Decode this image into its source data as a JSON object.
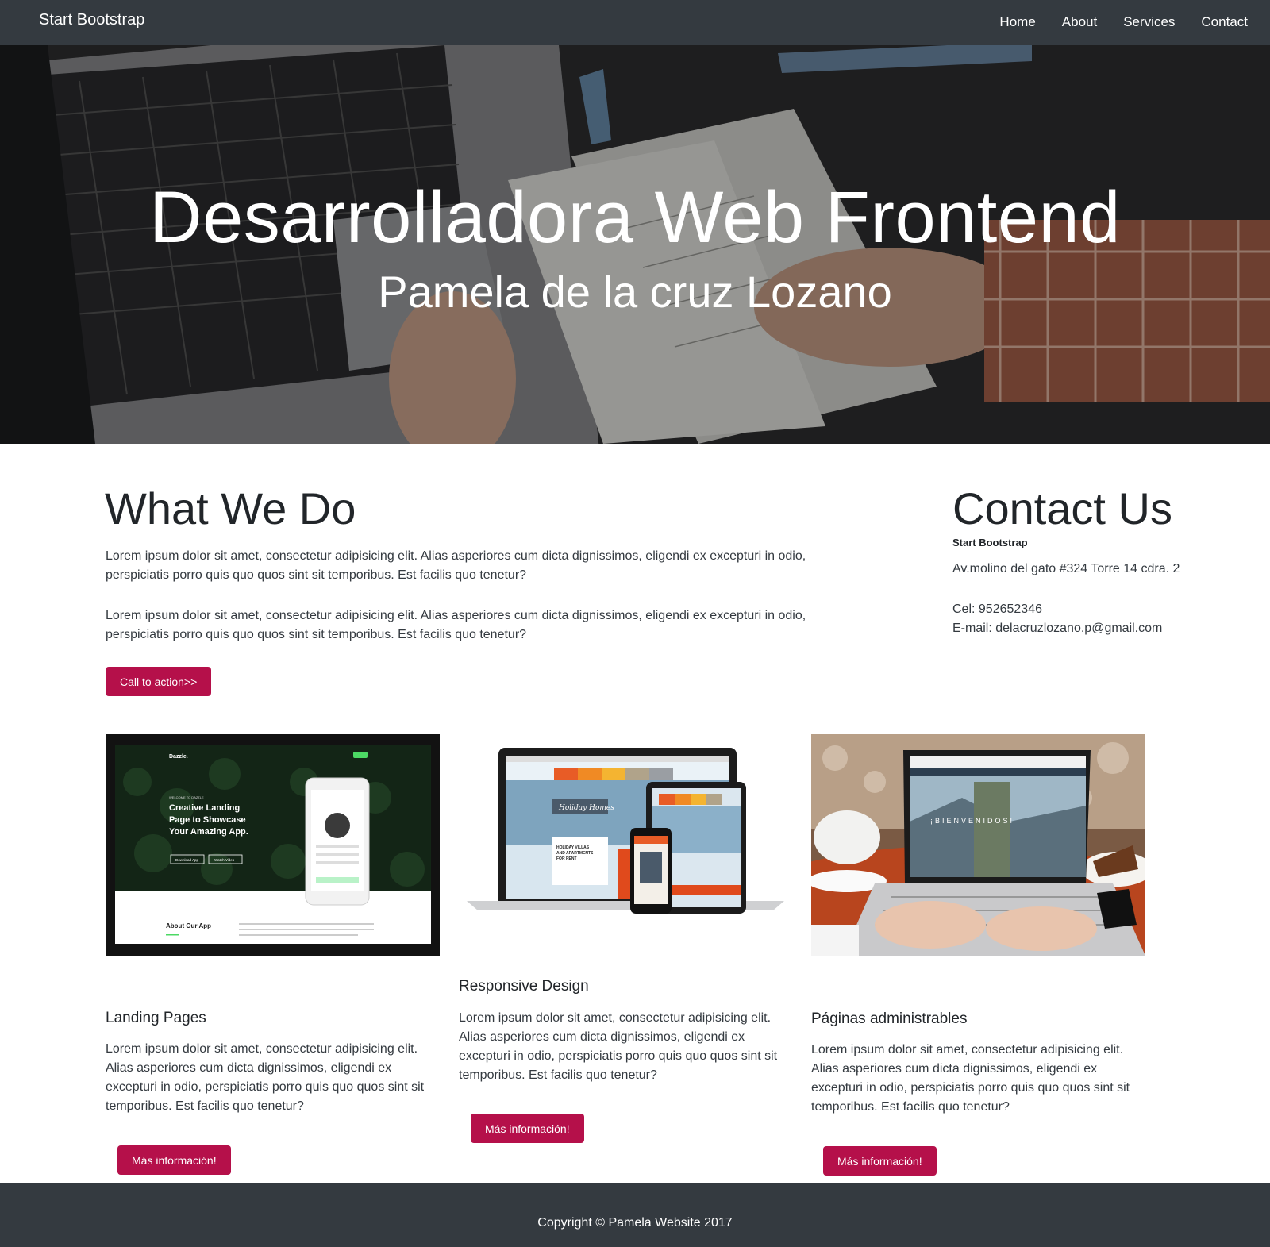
{
  "nav": {
    "brand": "Start Bootstrap",
    "links": [
      "Home",
      "About",
      "Services",
      "Contact"
    ]
  },
  "hero": {
    "title": "Desarrolladora Web Frontend",
    "subtitle": "Pamela de la cruz Lozano"
  },
  "what_we_do": {
    "heading": "What We Do",
    "paragraphs": [
      "Lorem ipsum dolor sit amet, consectetur adipisicing elit. Alias asperiores cum dicta dignissimos, eligendi ex excepturi in odio, perspiciatis porro quis quo quos sint sit temporibus. Est facilis quo tenetur?",
      "Lorem ipsum dolor sit amet, consectetur adipisicing elit. Alias asperiores cum dicta dignissimos, eligendi ex excepturi in odio, perspiciatis porro quis quo quos sint sit temporibus. Est facilis quo tenetur?"
    ],
    "cta": "Call to action>>"
  },
  "contact": {
    "heading": "Contact Us",
    "company": "Start Bootstrap",
    "address": "Av.molino del gato #324 Torre 14 cdra. 2",
    "phone": "Cel: 952652346",
    "email": "E-mail: delacruzlozano.p@gmail.com"
  },
  "cards": [
    {
      "title": "Landing Pages",
      "text": "Lorem ipsum dolor sit amet, consectetur adipisicing elit. Alias asperiores cum dicta dignissimos, eligendi ex excepturi in odio, perspiciatis porro quis quo quos sint sit temporibus. Est facilis quo tenetur?",
      "button": "Más información!",
      "screen": {
        "brand": "Dazzle.",
        "headline": [
          "Creative Landing",
          "Page to Showcase",
          "Your Amazing App."
        ],
        "welcome": "WELCOME TO DAZZLE",
        "download": "Download App",
        "video": "Watch Video",
        "about": "About Our App"
      }
    },
    {
      "title": "Responsive Design",
      "text": "Lorem ipsum dolor sit amet, consectetur adipisicing elit. Alias asperiores cum dicta dignissimos, eligendi ex excepturi in odio, perspiciatis porro quis quo quos sint sit temporibus. Est facilis quo tenetur?",
      "button": "Más información!",
      "screen": {
        "script": "Holiday Homes",
        "headline": [
          "HOLIDAY VILLAS",
          "AND APARTMENTS",
          "FOR RENT"
        ]
      }
    },
    {
      "title": "Páginas administrables",
      "text": "Lorem ipsum dolor sit amet, consectetur adipisicing elit. Alias asperiores cum dicta dignissimos, eligendi ex excepturi in odio, perspiciatis porro quis quo quos sint sit temporibus. Est facilis quo tenetur?",
      "button": "Más información!",
      "screen": {
        "welcome": "¡BIENVENIDOS!"
      }
    }
  ],
  "footer": {
    "copyright": "Copyright © Pamela Website 2017"
  },
  "colors": {
    "navbar": "#343a40",
    "accent": "#b5104a",
    "footer": "#343a40"
  }
}
